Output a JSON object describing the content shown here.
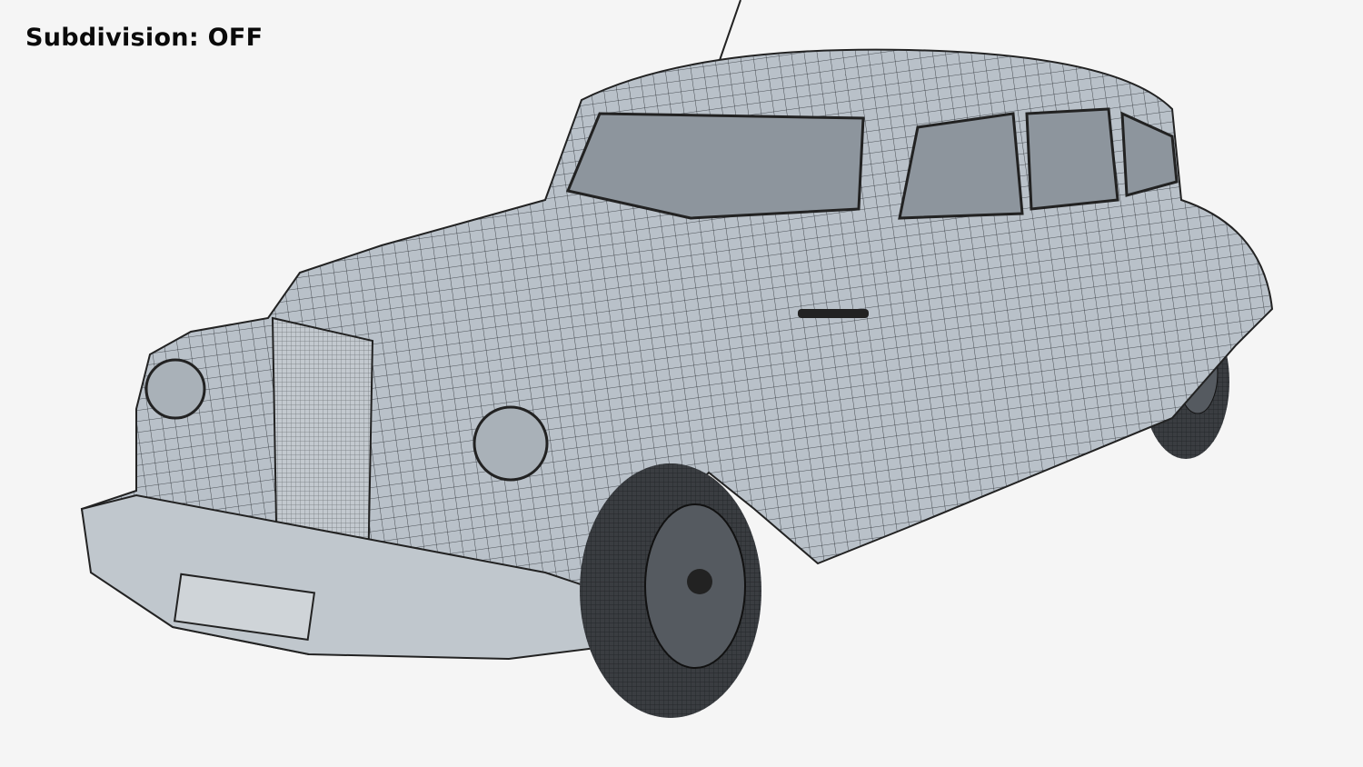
{
  "overlay": {
    "label": "Subdivision: OFF"
  },
  "render": {
    "subject": "wireframe-car",
    "colors": {
      "background": "#f5f5f5",
      "body": "#b9c1c9",
      "wire": "#2a2e33",
      "glass": "#8d959d",
      "tire": "#3a3d41"
    }
  }
}
